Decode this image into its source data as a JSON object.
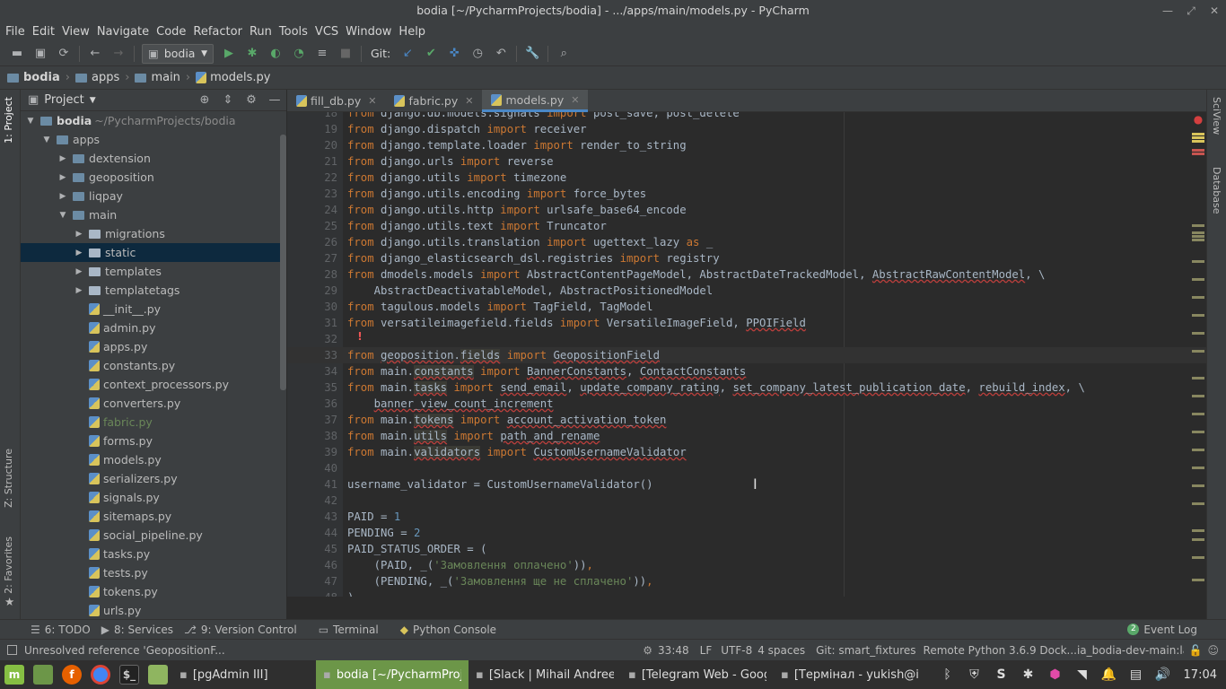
{
  "window": {
    "title": "bodia [~/PycharmProjects/bodia] - .../apps/main/models.py - PyCharm"
  },
  "menu": [
    "File",
    "Edit",
    "View",
    "Navigate",
    "Code",
    "Refactor",
    "Run",
    "Tools",
    "VCS",
    "Window",
    "Help"
  ],
  "toolbar": {
    "run_config": "bodia",
    "git_label": "Git:"
  },
  "breadcrumbs": [
    "bodia",
    "apps",
    "main",
    "models.py"
  ],
  "left_tabs": {
    "project": "1: Project",
    "structure": "Z: Structure",
    "favorites": "2: Favorites"
  },
  "right_tabs": {
    "sciview": "SciView",
    "database": "Database"
  },
  "project_panel": {
    "title": "Project",
    "root_name": "bodia",
    "root_path": "~/PycharmProjects/bodia",
    "items": [
      {
        "label": "apps",
        "type": "folder",
        "depth": 1,
        "expanded": true
      },
      {
        "label": "dextension",
        "type": "folder",
        "depth": 2,
        "expanded": false
      },
      {
        "label": "geoposition",
        "type": "folder",
        "depth": 2,
        "expanded": false
      },
      {
        "label": "liqpay",
        "type": "folder",
        "depth": 2,
        "expanded": false
      },
      {
        "label": "main",
        "type": "folder",
        "depth": 2,
        "expanded": true
      },
      {
        "label": "migrations",
        "type": "folder",
        "depth": 3,
        "expanded": false
      },
      {
        "label": "static",
        "type": "folder",
        "depth": 3,
        "expanded": false,
        "selected": true
      },
      {
        "label": "templates",
        "type": "folder",
        "depth": 3,
        "expanded": false
      },
      {
        "label": "templatetags",
        "type": "folder",
        "depth": 3,
        "expanded": false
      },
      {
        "label": "__init__.py",
        "type": "file",
        "depth": 3
      },
      {
        "label": "admin.py",
        "type": "file",
        "depth": 3
      },
      {
        "label": "apps.py",
        "type": "file",
        "depth": 3
      },
      {
        "label": "constants.py",
        "type": "file",
        "depth": 3
      },
      {
        "label": "context_processors.py",
        "type": "file",
        "depth": 3
      },
      {
        "label": "converters.py",
        "type": "file",
        "depth": 3
      },
      {
        "label": "fabric.py",
        "type": "file",
        "depth": 3,
        "modified": true
      },
      {
        "label": "forms.py",
        "type": "file",
        "depth": 3
      },
      {
        "label": "models.py",
        "type": "file",
        "depth": 3
      },
      {
        "label": "serializers.py",
        "type": "file",
        "depth": 3
      },
      {
        "label": "signals.py",
        "type": "file",
        "depth": 3
      },
      {
        "label": "sitemaps.py",
        "type": "file",
        "depth": 3
      },
      {
        "label": "social_pipeline.py",
        "type": "file",
        "depth": 3
      },
      {
        "label": "tasks.py",
        "type": "file",
        "depth": 3
      },
      {
        "label": "tests.py",
        "type": "file",
        "depth": 3
      },
      {
        "label": "tokens.py",
        "type": "file",
        "depth": 3
      },
      {
        "label": "urls.py",
        "type": "file",
        "depth": 3
      }
    ]
  },
  "tabs": [
    {
      "label": "fill_db.py",
      "active": false
    },
    {
      "label": "fabric.py",
      "active": false
    },
    {
      "label": "models.py",
      "active": true
    }
  ],
  "code_lines": [
    {
      "n": "18",
      "t": [
        [
          "kw",
          "from "
        ],
        [
          "",
          "django.db.models.signals "
        ],
        [
          "kw",
          "import "
        ],
        [
          "",
          "post_save, post_delete"
        ]
      ]
    },
    {
      "n": "19",
      "t": [
        [
          "kw",
          "from "
        ],
        [
          "",
          "django.dispatch "
        ],
        [
          "kw",
          "import "
        ],
        [
          "",
          "receiver"
        ]
      ]
    },
    {
      "n": "20",
      "t": [
        [
          "kw",
          "from "
        ],
        [
          "",
          "django.template.loader "
        ],
        [
          "kw",
          "import "
        ],
        [
          "",
          "render_to_string"
        ]
      ]
    },
    {
      "n": "21",
      "t": [
        [
          "kw",
          "from "
        ],
        [
          "",
          "django.urls "
        ],
        [
          "kw",
          "import "
        ],
        [
          "",
          "reverse"
        ]
      ]
    },
    {
      "n": "22",
      "t": [
        [
          "kw",
          "from "
        ],
        [
          "",
          "django.utils "
        ],
        [
          "kw",
          "import "
        ],
        [
          "",
          "timezone"
        ]
      ]
    },
    {
      "n": "23",
      "t": [
        [
          "kw",
          "from "
        ],
        [
          "",
          "django.utils.encoding "
        ],
        [
          "kw",
          "import "
        ],
        [
          "",
          "force_bytes"
        ]
      ]
    },
    {
      "n": "24",
      "t": [
        [
          "kw",
          "from "
        ],
        [
          "",
          "django.utils.http "
        ],
        [
          "kw",
          "import "
        ],
        [
          "",
          "urlsafe_base64_encode"
        ]
      ]
    },
    {
      "n": "25",
      "t": [
        [
          "kw",
          "from "
        ],
        [
          "",
          "django.utils.text "
        ],
        [
          "kw",
          "import "
        ],
        [
          "",
          "Truncator"
        ]
      ]
    },
    {
      "n": "26",
      "t": [
        [
          "kw",
          "from "
        ],
        [
          "",
          "django.utils.translation "
        ],
        [
          "kw",
          "import "
        ],
        [
          "",
          "ugettext_lazy "
        ],
        [
          "kw",
          "as "
        ],
        [
          "",
          "_"
        ]
      ]
    },
    {
      "n": "27",
      "t": [
        [
          "kw",
          "from "
        ],
        [
          "",
          "django_elasticsearch_dsl.registries "
        ],
        [
          "kw",
          "import "
        ],
        [
          "",
          "registry"
        ]
      ]
    },
    {
      "n": "28",
      "t": [
        [
          "kw",
          "from "
        ],
        [
          "",
          "dmodels.models "
        ],
        [
          "kw",
          "import "
        ],
        [
          "",
          "AbstractContentPageModel, AbstractDateTrackedModel, "
        ],
        [
          "err",
          "AbstractRawContentModel"
        ],
        [
          "",
          ", \\"
        ]
      ]
    },
    {
      "n": "29",
      "t": [
        [
          "",
          "    AbstractDeactivatableModel, AbstractPositionedModel"
        ]
      ]
    },
    {
      "n": "30",
      "t": [
        [
          "kw",
          "from "
        ],
        [
          "",
          "tagulous.models "
        ],
        [
          "kw",
          "import "
        ],
        [
          "",
          "TagField, TagModel"
        ]
      ]
    },
    {
      "n": "31",
      "t": [
        [
          "kw",
          "from "
        ],
        [
          "",
          "versatileimagefield.fields "
        ],
        [
          "kw",
          "import "
        ],
        [
          "",
          "VersatileImageField, "
        ],
        [
          "err",
          "PPOIField"
        ]
      ]
    },
    {
      "n": "32",
      "t": []
    },
    {
      "n": "33",
      "t": [
        [
          "kw",
          "from "
        ],
        [
          "err",
          "geoposition"
        ],
        [
          "",
          "."
        ],
        [
          "hl err",
          "fields"
        ],
        [
          "kw",
          " import "
        ],
        [
          "err",
          "GeopositionField"
        ]
      ]
    },
    {
      "n": "34",
      "t": [
        [
          "kw",
          "from "
        ],
        [
          "",
          "main."
        ],
        [
          "hl err",
          "constants"
        ],
        [
          "kw",
          " import "
        ],
        [
          "err",
          "BannerConstants"
        ],
        [
          "",
          ", "
        ],
        [
          "err",
          "ContactConstants"
        ]
      ]
    },
    {
      "n": "35",
      "t": [
        [
          "kw",
          "from "
        ],
        [
          "",
          "main."
        ],
        [
          "hl err",
          "tasks"
        ],
        [
          "kw",
          " import "
        ],
        [
          "err",
          "send_email"
        ],
        [
          "",
          ", "
        ],
        [
          "err",
          "update_company_rating"
        ],
        [
          "",
          ", "
        ],
        [
          "err",
          "set_company_latest_publication_date"
        ],
        [
          "",
          ", "
        ],
        [
          "err",
          "rebuild_index"
        ],
        [
          "",
          ", \\"
        ]
      ]
    },
    {
      "n": "36",
      "t": [
        [
          "",
          "    "
        ],
        [
          "err",
          "banner_view_count_increment"
        ]
      ]
    },
    {
      "n": "37",
      "t": [
        [
          "kw",
          "from "
        ],
        [
          "",
          "main."
        ],
        [
          "hl err",
          "tokens"
        ],
        [
          "kw",
          " import "
        ],
        [
          "err",
          "account_activation_token"
        ]
      ]
    },
    {
      "n": "38",
      "t": [
        [
          "kw",
          "from "
        ],
        [
          "",
          "main."
        ],
        [
          "hl err",
          "utils"
        ],
        [
          "kw",
          " import "
        ],
        [
          "err",
          "path_and_rename"
        ]
      ]
    },
    {
      "n": "39",
      "t": [
        [
          "kw",
          "from "
        ],
        [
          "",
          "main."
        ],
        [
          "hl err",
          "validators"
        ],
        [
          "kw",
          " import "
        ],
        [
          "err",
          "CustomUsernameValidator"
        ]
      ]
    },
    {
      "n": "40",
      "t": []
    },
    {
      "n": "41",
      "t": [
        [
          "",
          "username_validator = CustomUsernameValidator()"
        ]
      ]
    },
    {
      "n": "42",
      "t": []
    },
    {
      "n": "43",
      "t": [
        [
          "",
          "PAID = "
        ],
        [
          "num",
          "1"
        ]
      ]
    },
    {
      "n": "44",
      "t": [
        [
          "",
          "PENDING = "
        ],
        [
          "num",
          "2"
        ]
      ]
    },
    {
      "n": "45",
      "t": [
        [
          "",
          "PAID_STATUS_ORDER = ("
        ]
      ]
    },
    {
      "n": "46",
      "t": [
        [
          "",
          "    (PAID, _("
        ],
        [
          "str",
          "'Замовлення оплачено'"
        ],
        [
          "",
          "))"
        ],
        [
          "kw",
          ","
        ]
      ]
    },
    {
      "n": "47",
      "t": [
        [
          "",
          "    (PENDING, _("
        ],
        [
          "str",
          "'Замовлення ще не сплачено'"
        ],
        [
          "",
          "))"
        ],
        [
          "kw",
          ","
        ]
      ]
    },
    {
      "n": "48",
      "t": [
        [
          "",
          ")"
        ]
      ]
    }
  ],
  "bottom_tools": {
    "todo": "6: TODO",
    "services": "8: Services",
    "vcs": "9: Version Control",
    "terminal": "Terminal",
    "console": "Python Console",
    "event_log_count": "2",
    "event_log": "Event Log"
  },
  "status": {
    "message": "Unresolved reference 'GeopositionF...",
    "position": "33:48",
    "line_sep": "LF",
    "encoding": "UTF-8",
    "indent": "4 spaces",
    "git": "Git: smart_fixtures",
    "interpreter": "Remote Python 3.6.9 Dock...ia_bodia-dev-main:late..."
  },
  "taskbar": {
    "apps": [
      {
        "label": "[pgAdmin III]",
        "active": false
      },
      {
        "label": "bodia [~/PycharmProj...",
        "active": true
      },
      {
        "label": "[Slack | Mihail Andree...",
        "active": false
      },
      {
        "label": "[Telegram Web - Goog...",
        "active": false
      },
      {
        "label": "[Термінал - yukish@iv...",
        "active": false
      }
    ],
    "clock": "17:04"
  }
}
